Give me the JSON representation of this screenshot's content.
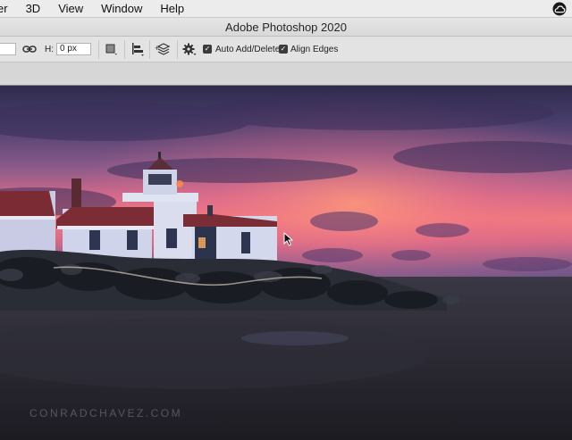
{
  "menubar": {
    "items": [
      "er",
      "3D",
      "View",
      "Window",
      "Help"
    ],
    "right_icon": "creative-cloud-icon"
  },
  "window": {
    "title": "Adobe Photoshop 2020"
  },
  "options_bar": {
    "width_value": "",
    "link_icon": "link-icon",
    "height_label": "H:",
    "height_value": "0 px",
    "frame_icon": "frame-icon",
    "align_icon": "align-icon",
    "stack_icon": "stack-add-icon",
    "gear_icon": "gear-icon",
    "auto_add_delete": {
      "label": "Auto Add/Delete",
      "checked": true
    },
    "align_edges": {
      "label": "Align Edges",
      "checked": true
    }
  },
  "canvas": {
    "image_description_icon": "lighthouse-photo",
    "watermark": "CONRADCHAVEZ.COM",
    "cursor_icon": "arrow-cursor-icon"
  },
  "colors": {
    "menubar_bg": "#ececec",
    "options_bg": "#e3e3e3",
    "sky_top": "#3a3358",
    "sky_glow": "#e8657a"
  }
}
